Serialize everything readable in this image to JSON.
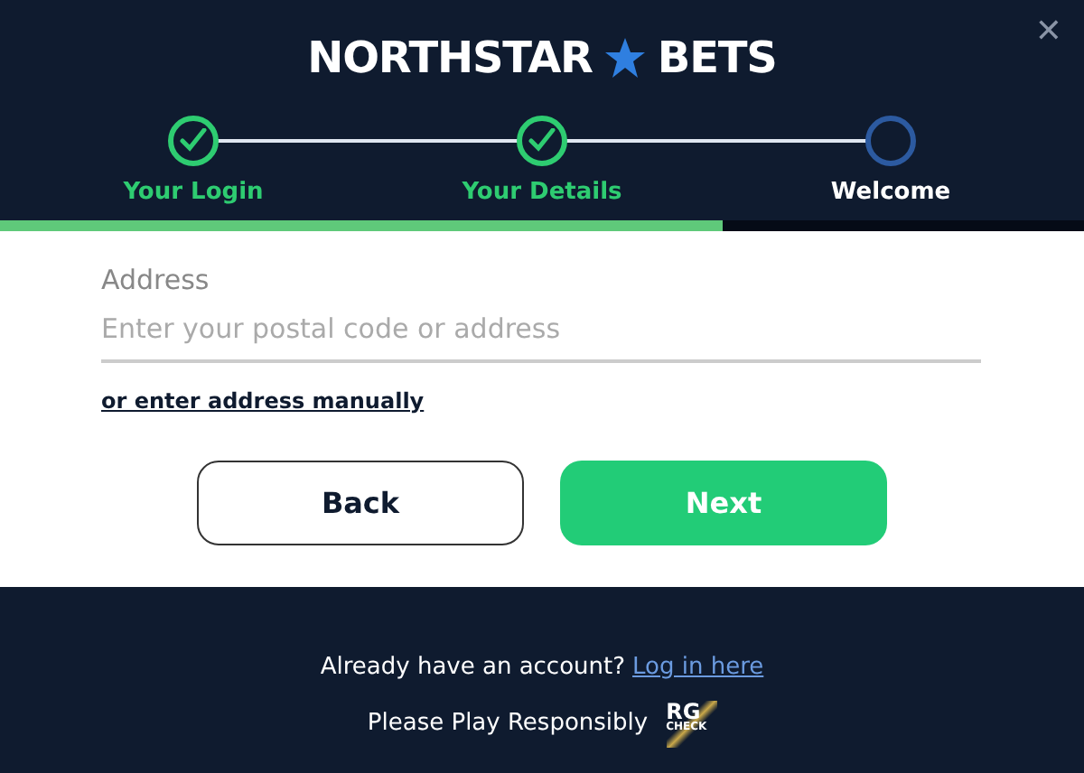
{
  "logo": {
    "left": "NORTHSTAR",
    "right": "BETS"
  },
  "close": {
    "label": "✕"
  },
  "steps": [
    {
      "label": "Your Login",
      "done": true
    },
    {
      "label": "Your Details",
      "done": true
    },
    {
      "label": "Welcome",
      "done": false
    }
  ],
  "progress": {
    "level": 0.667
  },
  "address": {
    "label": "Address",
    "placeholder": "Enter your postal code or address"
  },
  "manual_link": "or enter address manually",
  "buttons": [
    {
      "label": "Back",
      "kind": "secondary"
    },
    {
      "label": "Next",
      "kind": "primary"
    }
  ],
  "footer": {
    "prompt": "Already have an account?",
    "link": "Log in here",
    "responsible": "Please Play Responsibly",
    "badge": {
      "top": "RG",
      "bottom": "CHECK"
    }
  }
}
